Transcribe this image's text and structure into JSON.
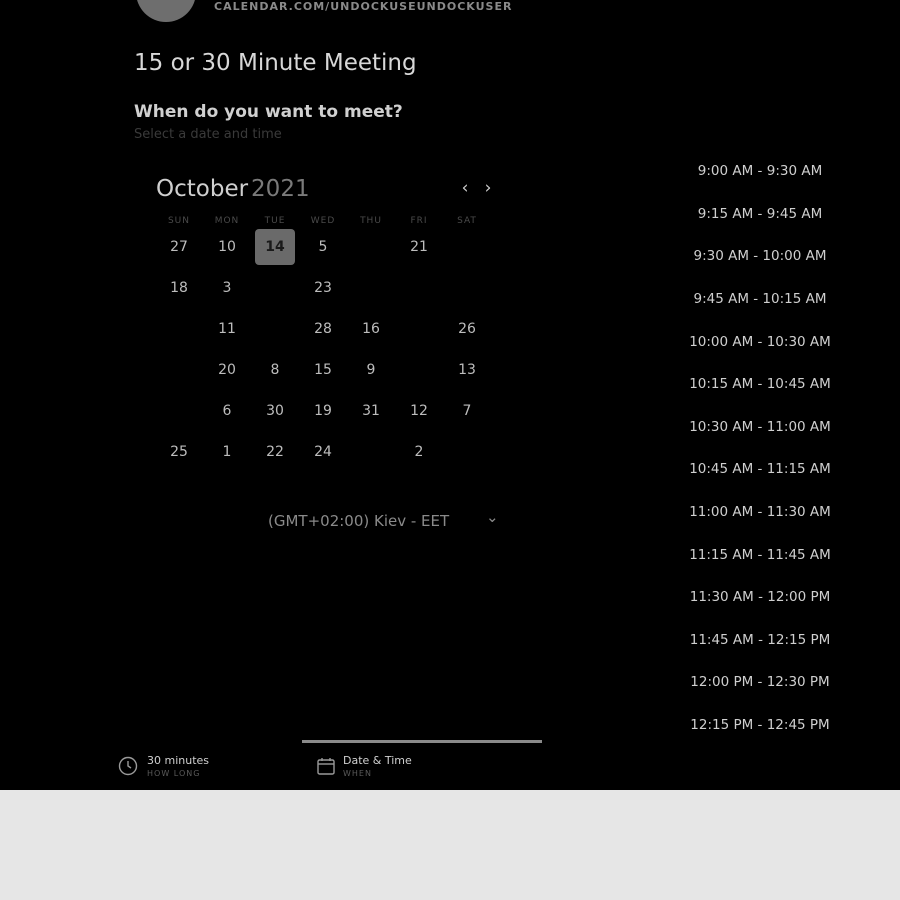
{
  "header": {
    "profile_url": "CALENDAR.COM/UNDOCKUSEUNDOCKUSER",
    "title": "15 or 30 Minute Meeting"
  },
  "booking": {
    "question": "When do you want to meet?",
    "hint": "Select a date and time"
  },
  "calendar": {
    "month": "October",
    "year": "2021",
    "weekdays": [
      "SUN",
      "MON",
      "TUE",
      "WED",
      "THU",
      "FRI",
      "SAT"
    ],
    "weeks": [
      [
        {
          "d": "27"
        },
        {
          "d": "10"
        },
        {
          "d": "14",
          "selected": true
        },
        {
          "d": "5"
        },
        {
          "d": "",
          "faint": true
        },
        {
          "d": "21"
        },
        {
          "d": "",
          "faint": true
        }
      ],
      [
        {
          "d": "18"
        },
        {
          "d": "3"
        },
        {
          "d": ""
        },
        {
          "d": "23"
        },
        {
          "d": ""
        },
        {
          "d": ""
        },
        {
          "d": ""
        }
      ],
      [
        {
          "d": "",
          "faint": true
        },
        {
          "d": "11"
        },
        {
          "d": "",
          "faint": true
        },
        {
          "d": "28"
        },
        {
          "d": "16"
        },
        {
          "d": "",
          "faint": true
        },
        {
          "d": "26"
        }
      ],
      [
        {
          "d": "",
          "faint": true
        },
        {
          "d": "20"
        },
        {
          "d": "8"
        },
        {
          "d": "15"
        },
        {
          "d": "9"
        },
        {
          "d": "",
          "faint": true
        },
        {
          "d": "13"
        }
      ],
      [
        {
          "d": ""
        },
        {
          "d": "6"
        },
        {
          "d": "30"
        },
        {
          "d": "19"
        },
        {
          "d": "31"
        },
        {
          "d": "12"
        },
        {
          "d": "7"
        }
      ],
      [
        {
          "d": "25"
        },
        {
          "d": "1"
        },
        {
          "d": "22"
        },
        {
          "d": "24"
        },
        {
          "d": "",
          "faint": true
        },
        {
          "d": "2"
        },
        {
          "d": "",
          "faint": true
        }
      ]
    ]
  },
  "timezone": {
    "value": "(GMT+02:00) Kiev - EET"
  },
  "slots": [
    "9:00 AM - 9:30 AM",
    "9:15 AM - 9:45 AM",
    "9:30 AM - 10:00 AM",
    "9:45 AM - 10:15 AM",
    "10:00 AM - 10:30 AM",
    "10:15 AM - 10:45 AM",
    "10:30 AM - 11:00 AM",
    "10:45 AM - 11:15 AM",
    "11:00 AM - 11:30 AM",
    "11:15 AM - 11:45 AM",
    "11:30 AM - 12:00 PM",
    "11:45 AM - 12:15 PM",
    "12:00 PM - 12:30 PM",
    "12:15 PM - 12:45 PM"
  ],
  "steps": [
    {
      "label": "30 minutes",
      "sub": "HOW LONG",
      "icon": "clock-icon"
    },
    {
      "label": "Date & Time",
      "sub": "WHEN",
      "icon": "calendar-icon"
    }
  ],
  "icons": {
    "prev": "‹",
    "next": "›",
    "chevron": "⌄"
  }
}
